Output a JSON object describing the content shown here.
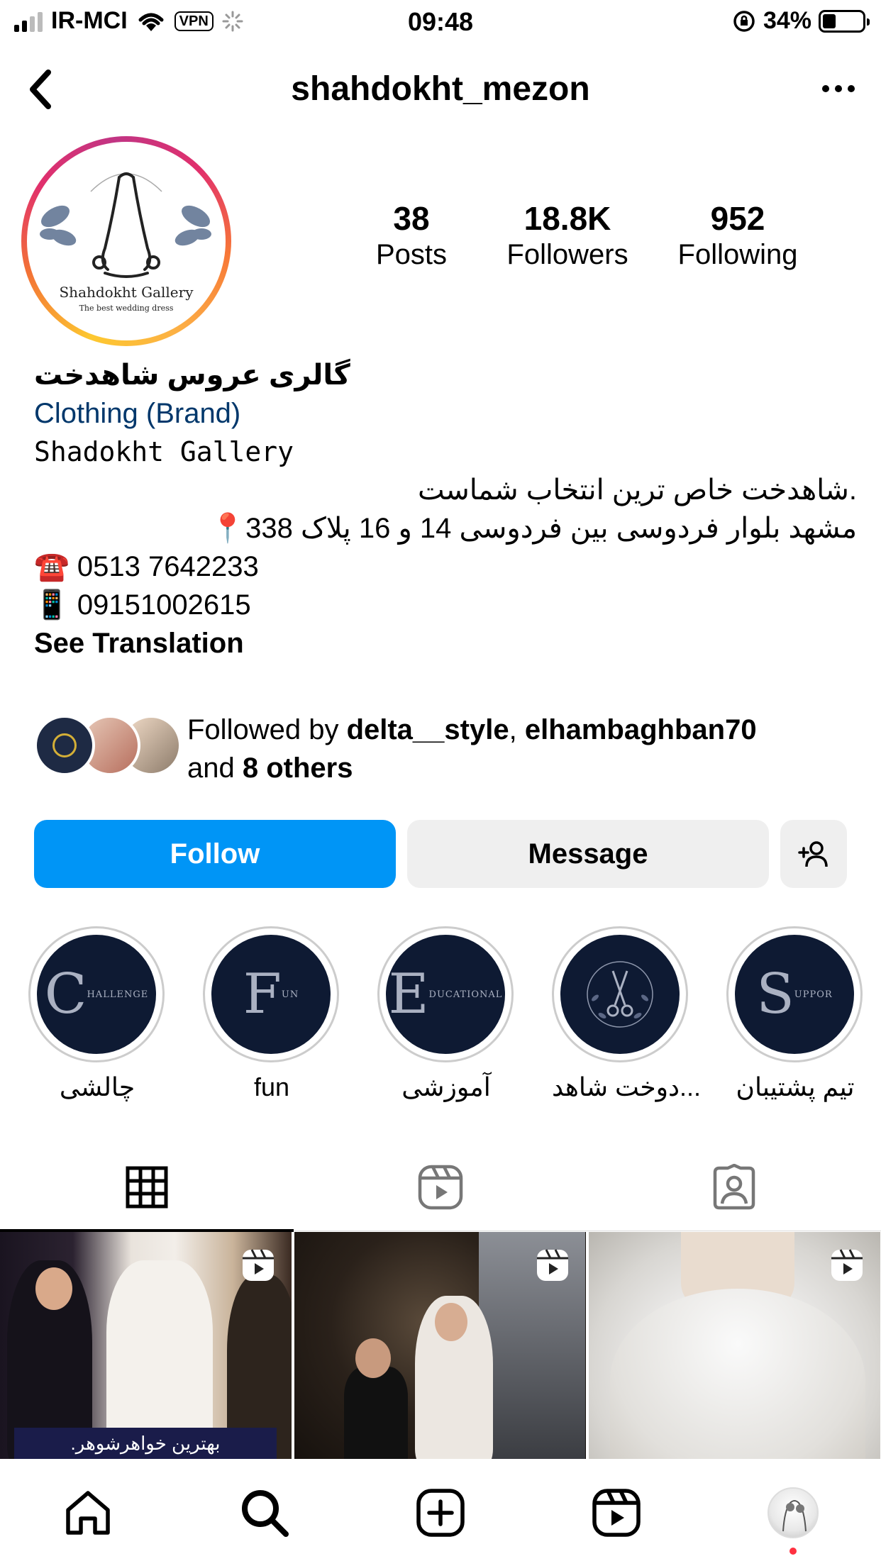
{
  "status_bar": {
    "carrier": "IR-MCI",
    "vpn": "VPN",
    "time": "09:48",
    "battery": "34%",
    "battery_level": 0.34
  },
  "header": {
    "username": "shahdokht_mezon"
  },
  "avatar": {
    "title": "Shahdokht Gallery",
    "subtitle": "The best wedding dress"
  },
  "stats": [
    {
      "value": "38",
      "label": "Posts"
    },
    {
      "value": "18.8K",
      "label": "Followers"
    },
    {
      "value": "952",
      "label": "Following"
    }
  ],
  "bio": {
    "name": "گالری عروس شاهدخت",
    "category": "Clothing (Brand)",
    "line1": "Shadokht Gallery",
    "line2": ".شاهدخت خاص ترین انتخاب شماست",
    "line3": "مشهد بلوار فردوسی بین فردوسی 14 و 16 پلاک 338📍",
    "line4": "☎️ 0513 7642233",
    "line5": "📱 09151002615",
    "see_translation": "See Translation"
  },
  "followed_by": {
    "prefix": "Followed by ",
    "user1": "delta__style",
    "sep": ", ",
    "user2": "elhambaghban70",
    "and": "and ",
    "others": "8 others"
  },
  "buttons": {
    "follow": "Follow",
    "message": "Message"
  },
  "highlights": [
    {
      "label": "چالشی",
      "letter": "C",
      "small": "HALLENGE"
    },
    {
      "label": "fun",
      "letter": "F",
      "small": "UN"
    },
    {
      "label": "آموزشی",
      "letter": "E",
      "small": "DUCATIONAL"
    },
    {
      "label": "دوخت شاهد...",
      "letter": "",
      "small": ""
    },
    {
      "label": "تیم پشتیبان",
      "letter": "S",
      "small": "UPPOR"
    }
  ],
  "posts": [
    {
      "caption": "بهترین خواهرشوهر."
    },
    {
      "caption": ""
    },
    {
      "caption": ""
    }
  ],
  "colors": {
    "accent": "#0095f6",
    "category": "#00376b",
    "highlight_bg": "#0e1a33"
  }
}
